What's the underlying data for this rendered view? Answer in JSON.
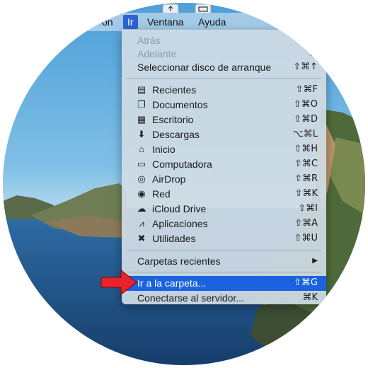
{
  "menubar": {
    "items": [
      {
        "label": "on"
      },
      {
        "label": "Ir"
      },
      {
        "label": "Ventana"
      },
      {
        "label": "Ayuda"
      }
    ]
  },
  "menu": {
    "items": [
      {
        "label": "Atrás",
        "shortcut": "",
        "icon": ""
      },
      {
        "label": "Adelante",
        "shortcut": "⌘",
        "icon": ""
      },
      {
        "label": "Seleccionar disco de arranque",
        "shortcut": "⇧⌘↑",
        "icon": ""
      },
      {
        "label": "Recientes",
        "shortcut": "⇧⌘F",
        "icon": "recents-icon"
      },
      {
        "label": "Documentos",
        "shortcut": "⇧⌘O",
        "icon": "documents-icon"
      },
      {
        "label": "Escritorio",
        "shortcut": "⇧⌘D",
        "icon": "desktop-icon"
      },
      {
        "label": "Descargas",
        "shortcut": "⌥⌘L",
        "icon": "downloads-icon"
      },
      {
        "label": "Inicio",
        "shortcut": "⇧⌘H",
        "icon": "home-icon"
      },
      {
        "label": "Computadora",
        "shortcut": "⇧⌘C",
        "icon": "computer-icon"
      },
      {
        "label": "AirDrop",
        "shortcut": "⇧⌘R",
        "icon": "airdrop-icon"
      },
      {
        "label": "Red",
        "shortcut": "⇧⌘K",
        "icon": "network-icon"
      },
      {
        "label": "iCloud Drive",
        "shortcut": "⇧⌘I",
        "icon": "icloud-icon"
      },
      {
        "label": "Aplicaciones",
        "shortcut": "⇧⌘A",
        "icon": "applications-icon"
      },
      {
        "label": "Utilidades",
        "shortcut": "⇧⌘U",
        "icon": "utilities-icon"
      },
      {
        "label": "Carpetas recientes",
        "shortcut": "▶",
        "icon": ""
      },
      {
        "label": "Ir a la carpeta...",
        "shortcut": "⇧⌘G",
        "icon": ""
      },
      {
        "label": "Conectarse al servidor...",
        "shortcut": "⌘K",
        "icon": ""
      }
    ]
  },
  "colors": {
    "highlight": "#1b62e0",
    "arrow": "#e8232b"
  }
}
